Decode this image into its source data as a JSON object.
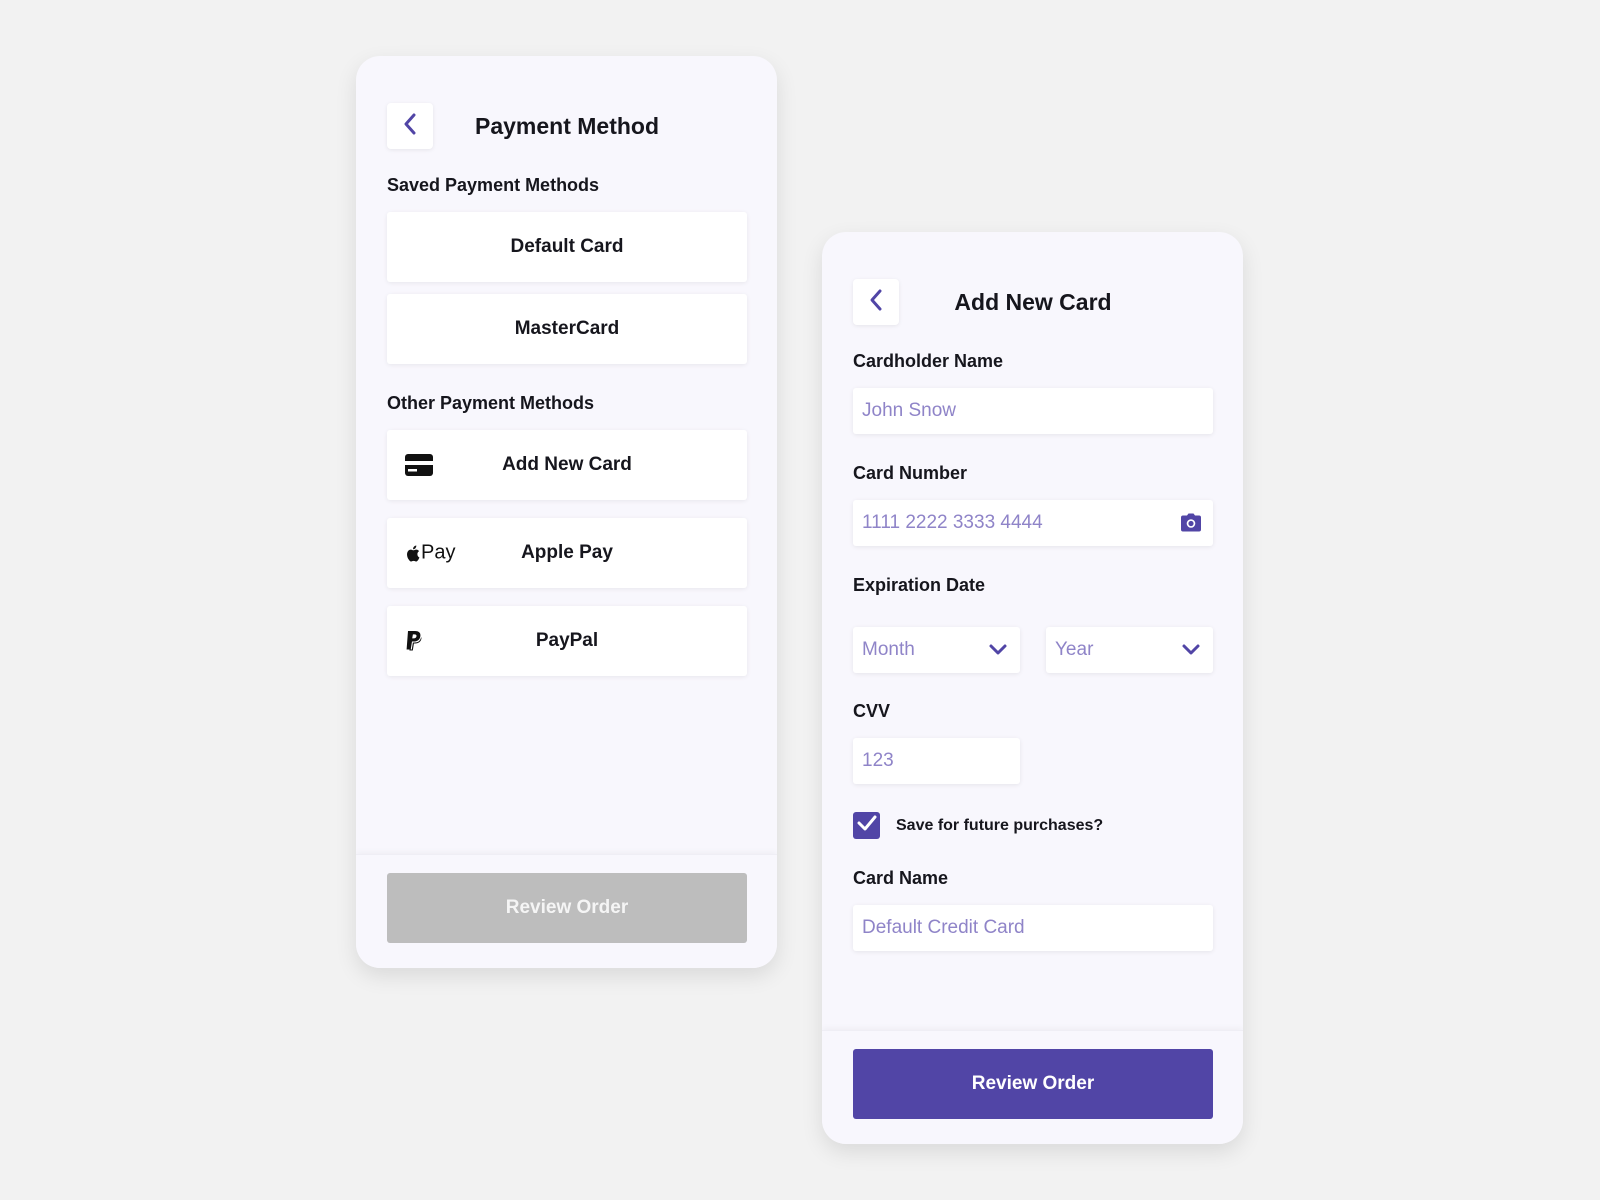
{
  "colors": {
    "background": "#f2f2f2",
    "card": "#f8f7fd",
    "accent": "#5145a6",
    "placeholder": "#8f84c8",
    "disabled_button": "#bdbdbd"
  },
  "payment_method_screen": {
    "back_icon": "chevron-left-icon",
    "title": "Payment Method",
    "saved_section_label": "Saved Payment Methods",
    "saved_methods": [
      {
        "label": "Default Card"
      },
      {
        "label": "MasterCard"
      }
    ],
    "other_section_label": "Other Payment Methods",
    "other_methods": [
      {
        "label": "Add New Card",
        "icon": "credit-card-icon"
      },
      {
        "label": "Apple Pay",
        "icon": "apple-pay-icon",
        "icon_text": "Pay"
      },
      {
        "label": "PayPal",
        "icon": "paypal-icon"
      }
    ],
    "review_button": {
      "label": "Review Order",
      "state": "disabled"
    }
  },
  "add_card_screen": {
    "back_icon": "chevron-left-icon",
    "title": "Add New Card",
    "cardholder": {
      "label": "Cardholder Name",
      "placeholder": "John Snow"
    },
    "card_number": {
      "label": "Card Number",
      "placeholder": "1111 2222 3333 4444",
      "icon": "camera-icon"
    },
    "expiration": {
      "label": "Expiration Date",
      "month_placeholder": "Month",
      "year_placeholder": "Year",
      "icon": "chevron-down-icon"
    },
    "cvv": {
      "label": "CVV",
      "placeholder": "123"
    },
    "save_checkbox": {
      "label": "Save for future purchases?",
      "checked": true
    },
    "card_name": {
      "label": "Card Name",
      "placeholder": "Default Credit Card"
    },
    "review_button": {
      "label": "Review Order",
      "state": "enabled"
    }
  }
}
